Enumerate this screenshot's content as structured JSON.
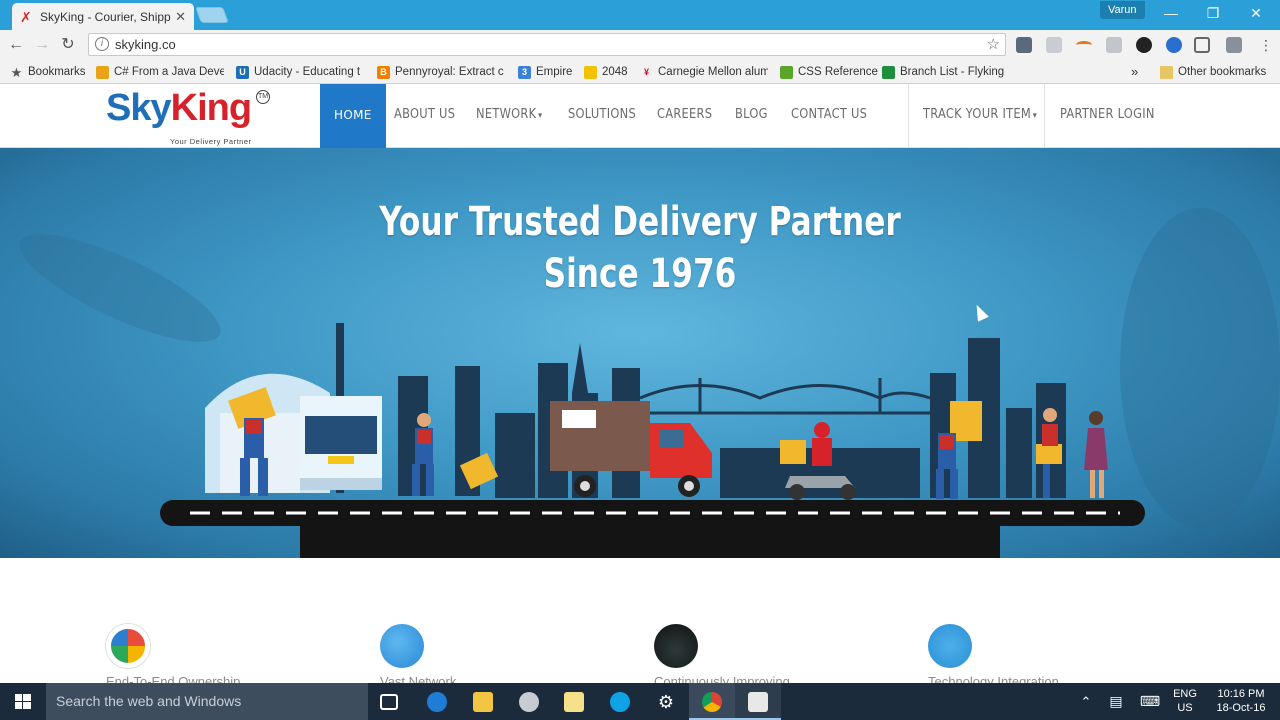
{
  "browser": {
    "tab_title": "SkyKing - Courier, Shippi",
    "profile_name": "Varun",
    "url": "skyking.co",
    "window_controls": {
      "minimize": "—",
      "maximize": "❐",
      "close": "✕"
    }
  },
  "bookmarks": {
    "label": "Bookmarks",
    "items": [
      {
        "label": "C# From a Java Devel",
        "color": "#e8a317"
      },
      {
        "label": "Udacity - Educating t",
        "color": "#1f6fb8"
      },
      {
        "label": "Pennyroyal: Extract c",
        "color": "#f57d00"
      },
      {
        "label": "Empire",
        "color": "#3b82d6"
      },
      {
        "label": "2048",
        "color": "#f2c200"
      },
      {
        "label": "Carnegie Mellon alum",
        "color": "#c41230"
      },
      {
        "label": "CSS Reference",
        "color": "#5aa62b"
      },
      {
        "label": "Branch List - Flyking",
        "color": "#1e8e3e"
      }
    ],
    "overflow": "»",
    "other": "Other bookmarks"
  },
  "site": {
    "logo": {
      "sky": "Sky",
      "king": "King",
      "tm": "TM",
      "tagline": "Your Delivery Partner"
    },
    "nav": {
      "home": "HOME",
      "about": "ABOUT US",
      "network": "NETWORK",
      "solutions": "SOLUTIONS",
      "careers": "CAREERS",
      "blog": "BLOG",
      "contact": "CONTACT US",
      "track": "TRACK YOUR ITEM",
      "partner": "PARTNER LOGIN"
    },
    "hero": {
      "line1": "Your Trusted Delivery Partner",
      "line2": "Since 1976"
    },
    "features": [
      {
        "label": "End-To-End Ownership"
      },
      {
        "label": "Vast Network"
      },
      {
        "label": "Continuously Improving"
      },
      {
        "label": "Technology Integration"
      }
    ],
    "colors": {
      "brand_blue": "#1f78c8",
      "brand_red": "#d6232b"
    }
  },
  "taskbar": {
    "search_placeholder": "Search the web and Windows",
    "lang": "ENG",
    "region": "US",
    "time": "10:16 PM",
    "date": "18-Oct-16"
  }
}
